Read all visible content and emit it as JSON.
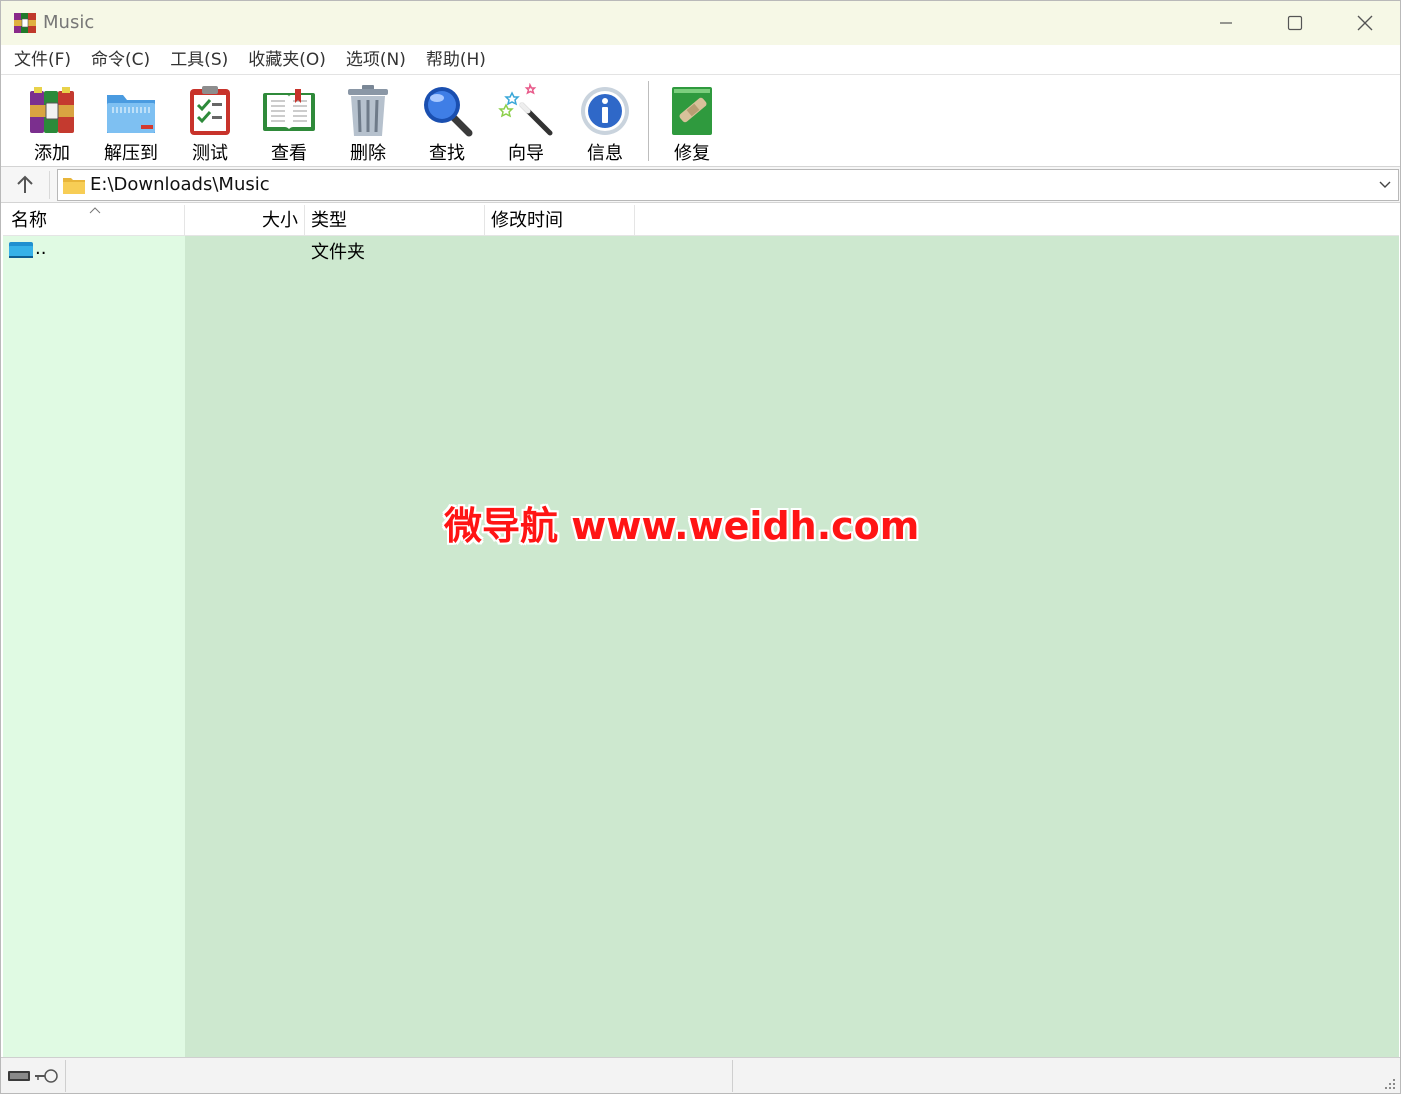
{
  "window": {
    "title": "Music",
    "controls": {
      "minimize": "minimize",
      "maximize": "maximize",
      "close": "close"
    }
  },
  "menu": [
    {
      "label": "文件(F)"
    },
    {
      "label": "命令(C)"
    },
    {
      "label": "工具(S)"
    },
    {
      "label": "收藏夹(O)"
    },
    {
      "label": "选项(N)"
    },
    {
      "label": "帮助(H)"
    }
  ],
  "toolbar": [
    {
      "label": "添加",
      "icon": "add-archive-icon"
    },
    {
      "label": "解压到",
      "icon": "extract-folder-icon"
    },
    {
      "label": "测试",
      "icon": "test-clipboard-icon"
    },
    {
      "label": "查看",
      "icon": "view-book-icon"
    },
    {
      "label": "删除",
      "icon": "trash-icon"
    },
    {
      "label": "查找",
      "icon": "magnifier-icon"
    },
    {
      "label": "向导",
      "icon": "wizard-wand-icon"
    },
    {
      "label": "信息",
      "icon": "info-icon"
    },
    {
      "label": "修复",
      "icon": "repair-bandage-icon"
    }
  ],
  "address": {
    "path": "E:\\Downloads\\Music"
  },
  "columns": {
    "name": "名称",
    "size": "大小",
    "type": "类型",
    "modified": "修改时间"
  },
  "rows": [
    {
      "name": "..",
      "size": "",
      "type": "文件夹",
      "modified": ""
    }
  ],
  "watermark": "微导航 www.weidh.com",
  "colors": {
    "titlebar": "#f6f8e6",
    "list_bg": "#cde8cf",
    "name_col_bg": "#e0fae3",
    "watermark": "#ff1414"
  }
}
